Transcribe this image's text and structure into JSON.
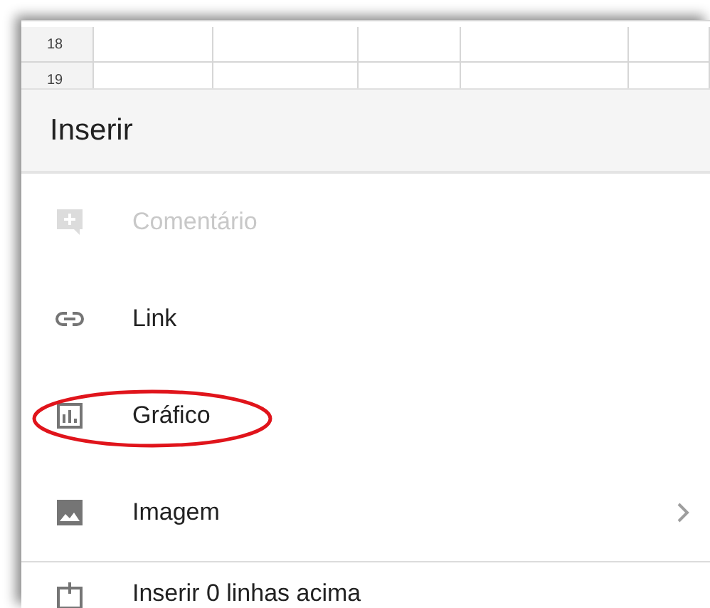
{
  "grid": {
    "rows": [
      {
        "number": "18"
      },
      {
        "number": "19"
      }
    ]
  },
  "menu": {
    "title": "Inserir",
    "items": [
      {
        "label": "Comentário",
        "kind": "comment",
        "disabled": true,
        "highlighted": false,
        "submenu": false,
        "divider_before": false
      },
      {
        "label": "Link",
        "kind": "link",
        "disabled": false,
        "highlighted": false,
        "submenu": false,
        "divider_before": false
      },
      {
        "label": "Gráfico",
        "kind": "chart",
        "disabled": false,
        "highlighted": true,
        "submenu": false,
        "divider_before": false
      },
      {
        "label": "Imagem",
        "kind": "image",
        "disabled": false,
        "highlighted": false,
        "submenu": true,
        "divider_before": false
      },
      {
        "label": "Inserir 0 linhas acima",
        "kind": "rows",
        "disabled": false,
        "highlighted": false,
        "submenu": false,
        "divider_before": true
      }
    ]
  }
}
